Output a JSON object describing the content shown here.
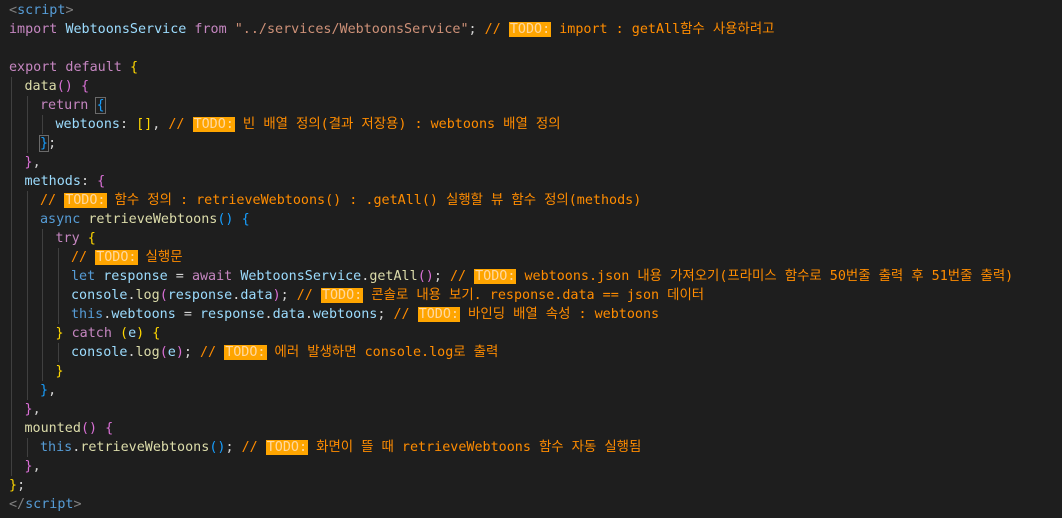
{
  "editor": {
    "language": "javascript",
    "lines": [
      {
        "indent": 0,
        "tokens": [
          {
            "t": "<",
            "c": "tag"
          },
          {
            "t": "script",
            "c": "tagn"
          },
          {
            "t": ">",
            "c": "tag"
          }
        ]
      },
      {
        "indent": 0,
        "tokens": [
          {
            "t": "import ",
            "c": "kw"
          },
          {
            "t": "WebtoonsService",
            "c": "var"
          },
          {
            "t": " from ",
            "c": "kw"
          },
          {
            "t": "\"../services/WebtoonsService\"",
            "c": "str"
          },
          {
            "t": "; ",
            "c": "txt"
          },
          {
            "t": "// ",
            "c": "cmt"
          },
          {
            "t": "TODO:",
            "c": "todo"
          },
          {
            "t": " import : getAll함수 사용하려고",
            "c": "cmt"
          }
        ]
      },
      {
        "indent": 0,
        "tokens": []
      },
      {
        "indent": 0,
        "tokens": [
          {
            "t": "export default ",
            "c": "kw"
          },
          {
            "t": "{",
            "c": "br1"
          }
        ]
      },
      {
        "indent": 1,
        "tokens": [
          {
            "t": "data",
            "c": "fn"
          },
          {
            "t": "()",
            "c": "br2"
          },
          {
            "t": " ",
            "c": "txt"
          },
          {
            "t": "{",
            "c": "br2"
          }
        ]
      },
      {
        "indent": 2,
        "tokens": [
          {
            "t": "return ",
            "c": "kw"
          },
          {
            "t": "{",
            "c": "br3",
            "match": true
          }
        ]
      },
      {
        "indent": 3,
        "tokens": [
          {
            "t": "webtoons",
            "c": "var"
          },
          {
            "t": ": ",
            "c": "txt"
          },
          {
            "t": "[]",
            "c": "br1"
          },
          {
            "t": ", ",
            "c": "txt"
          },
          {
            "t": "// ",
            "c": "cmt"
          },
          {
            "t": "TODO:",
            "c": "todo"
          },
          {
            "t": " 빈 배열 정의(결과 저장용) : webtoons 배열 정의",
            "c": "cmt"
          }
        ]
      },
      {
        "indent": 2,
        "tokens": [
          {
            "t": "}",
            "c": "br3",
            "match": true
          },
          {
            "t": ";",
            "c": "txt"
          }
        ]
      },
      {
        "indent": 1,
        "tokens": [
          {
            "t": "}",
            "c": "br2"
          },
          {
            "t": ",",
            "c": "txt"
          }
        ]
      },
      {
        "indent": 1,
        "tokens": [
          {
            "t": "methods",
            "c": "var"
          },
          {
            "t": ": ",
            "c": "txt"
          },
          {
            "t": "{",
            "c": "br2"
          }
        ]
      },
      {
        "indent": 2,
        "tokens": [
          {
            "t": "// ",
            "c": "cmt"
          },
          {
            "t": "TODO:",
            "c": "todo"
          },
          {
            "t": " 함수 정의 : retrieveWebtoons() : .getAll() 실행할 뷰 함수 정의(methods)",
            "c": "cmt"
          }
        ]
      },
      {
        "indent": 2,
        "tokens": [
          {
            "t": "async ",
            "c": "tagn"
          },
          {
            "t": "retrieveWebtoons",
            "c": "fn"
          },
          {
            "t": "()",
            "c": "br3"
          },
          {
            "t": " ",
            "c": "txt"
          },
          {
            "t": "{",
            "c": "br3"
          }
        ]
      },
      {
        "indent": 3,
        "tokens": [
          {
            "t": "try ",
            "c": "kw"
          },
          {
            "t": "{",
            "c": "br1"
          }
        ]
      },
      {
        "indent": 4,
        "tokens": [
          {
            "t": "// ",
            "c": "cmt"
          },
          {
            "t": "TODO:",
            "c": "todo"
          },
          {
            "t": " 실행문",
            "c": "cmt"
          }
        ]
      },
      {
        "indent": 4,
        "tokens": [
          {
            "t": "let ",
            "c": "tagn"
          },
          {
            "t": "response",
            "c": "var"
          },
          {
            "t": " = ",
            "c": "txt"
          },
          {
            "t": "await ",
            "c": "kw"
          },
          {
            "t": "WebtoonsService",
            "c": "var"
          },
          {
            "t": ".",
            "c": "txt"
          },
          {
            "t": "getAll",
            "c": "fn"
          },
          {
            "t": "()",
            "c": "br2"
          },
          {
            "t": "; ",
            "c": "txt"
          },
          {
            "t": "// ",
            "c": "cmt"
          },
          {
            "t": "TODO:",
            "c": "todo"
          },
          {
            "t": " webtoons.json 내용 가져오기(프라미스 함수로 50번줄 출력 후 51번줄 출력)",
            "c": "cmt"
          }
        ]
      },
      {
        "indent": 4,
        "tokens": [
          {
            "t": "console",
            "c": "var"
          },
          {
            "t": ".",
            "c": "txt"
          },
          {
            "t": "log",
            "c": "fn"
          },
          {
            "t": "(",
            "c": "br2"
          },
          {
            "t": "response",
            "c": "var"
          },
          {
            "t": ".",
            "c": "txt"
          },
          {
            "t": "data",
            "c": "var"
          },
          {
            "t": ")",
            "c": "br2"
          },
          {
            "t": "; ",
            "c": "txt"
          },
          {
            "t": "// ",
            "c": "cmt"
          },
          {
            "t": "TODO:",
            "c": "todo"
          },
          {
            "t": " 콘솔로 내용 보기. response.data == json 데이터",
            "c": "cmt"
          }
        ]
      },
      {
        "indent": 4,
        "tokens": [
          {
            "t": "this",
            "c": "this"
          },
          {
            "t": ".",
            "c": "txt"
          },
          {
            "t": "webtoons",
            "c": "var"
          },
          {
            "t": " = ",
            "c": "txt"
          },
          {
            "t": "response",
            "c": "var"
          },
          {
            "t": ".",
            "c": "txt"
          },
          {
            "t": "data",
            "c": "var"
          },
          {
            "t": ".",
            "c": "txt"
          },
          {
            "t": "webtoons",
            "c": "var"
          },
          {
            "t": "; ",
            "c": "txt"
          },
          {
            "t": "// ",
            "c": "cmt"
          },
          {
            "t": "TODO:",
            "c": "todo"
          },
          {
            "t": " 바인딩 배열 속성 : webtoons",
            "c": "cmt"
          }
        ]
      },
      {
        "indent": 3,
        "tokens": [
          {
            "t": "}",
            "c": "br1"
          },
          {
            "t": " catch ",
            "c": "kw"
          },
          {
            "t": "(",
            "c": "br1"
          },
          {
            "t": "e",
            "c": "var"
          },
          {
            "t": ")",
            "c": "br1"
          },
          {
            "t": " ",
            "c": "txt"
          },
          {
            "t": "{",
            "c": "br1"
          }
        ]
      },
      {
        "indent": 4,
        "tokens": [
          {
            "t": "console",
            "c": "var"
          },
          {
            "t": ".",
            "c": "txt"
          },
          {
            "t": "log",
            "c": "fn"
          },
          {
            "t": "(",
            "c": "br2"
          },
          {
            "t": "e",
            "c": "var"
          },
          {
            "t": ")",
            "c": "br2"
          },
          {
            "t": "; ",
            "c": "txt"
          },
          {
            "t": "// ",
            "c": "cmt"
          },
          {
            "t": "TODO:",
            "c": "todo"
          },
          {
            "t": " 에러 발생하면 console.log로 출력",
            "c": "cmt"
          }
        ]
      },
      {
        "indent": 3,
        "tokens": [
          {
            "t": "}",
            "c": "br1"
          }
        ]
      },
      {
        "indent": 2,
        "tokens": [
          {
            "t": "}",
            "c": "br3"
          },
          {
            "t": ",",
            "c": "txt"
          }
        ]
      },
      {
        "indent": 1,
        "tokens": [
          {
            "t": "}",
            "c": "br2"
          },
          {
            "t": ",",
            "c": "txt"
          }
        ]
      },
      {
        "indent": 1,
        "tokens": [
          {
            "t": "mounted",
            "c": "fn"
          },
          {
            "t": "()",
            "c": "br2"
          },
          {
            "t": " ",
            "c": "txt"
          },
          {
            "t": "{",
            "c": "br2"
          }
        ]
      },
      {
        "indent": 2,
        "tokens": [
          {
            "t": "this",
            "c": "this"
          },
          {
            "t": ".",
            "c": "txt"
          },
          {
            "t": "retrieveWebtoons",
            "c": "fn"
          },
          {
            "t": "()",
            "c": "br3"
          },
          {
            "t": "; ",
            "c": "txt"
          },
          {
            "t": "// ",
            "c": "cmt"
          },
          {
            "t": "TODO:",
            "c": "todo"
          },
          {
            "t": " 화면이 뜰 때 retrieveWebtoons 함수 자동 실행됨",
            "c": "cmt"
          }
        ]
      },
      {
        "indent": 1,
        "tokens": [
          {
            "t": "}",
            "c": "br2"
          },
          {
            "t": ",",
            "c": "txt"
          }
        ]
      },
      {
        "indent": 0,
        "tokens": [
          {
            "t": "}",
            "c": "br1"
          },
          {
            "t": ";",
            "c": "txt"
          }
        ]
      },
      {
        "indent": 0,
        "tokens": [
          {
            "t": "</",
            "c": "tag"
          },
          {
            "t": "script",
            "c": "tagn"
          },
          {
            "t": ">",
            "c": "tag"
          }
        ]
      }
    ]
  }
}
